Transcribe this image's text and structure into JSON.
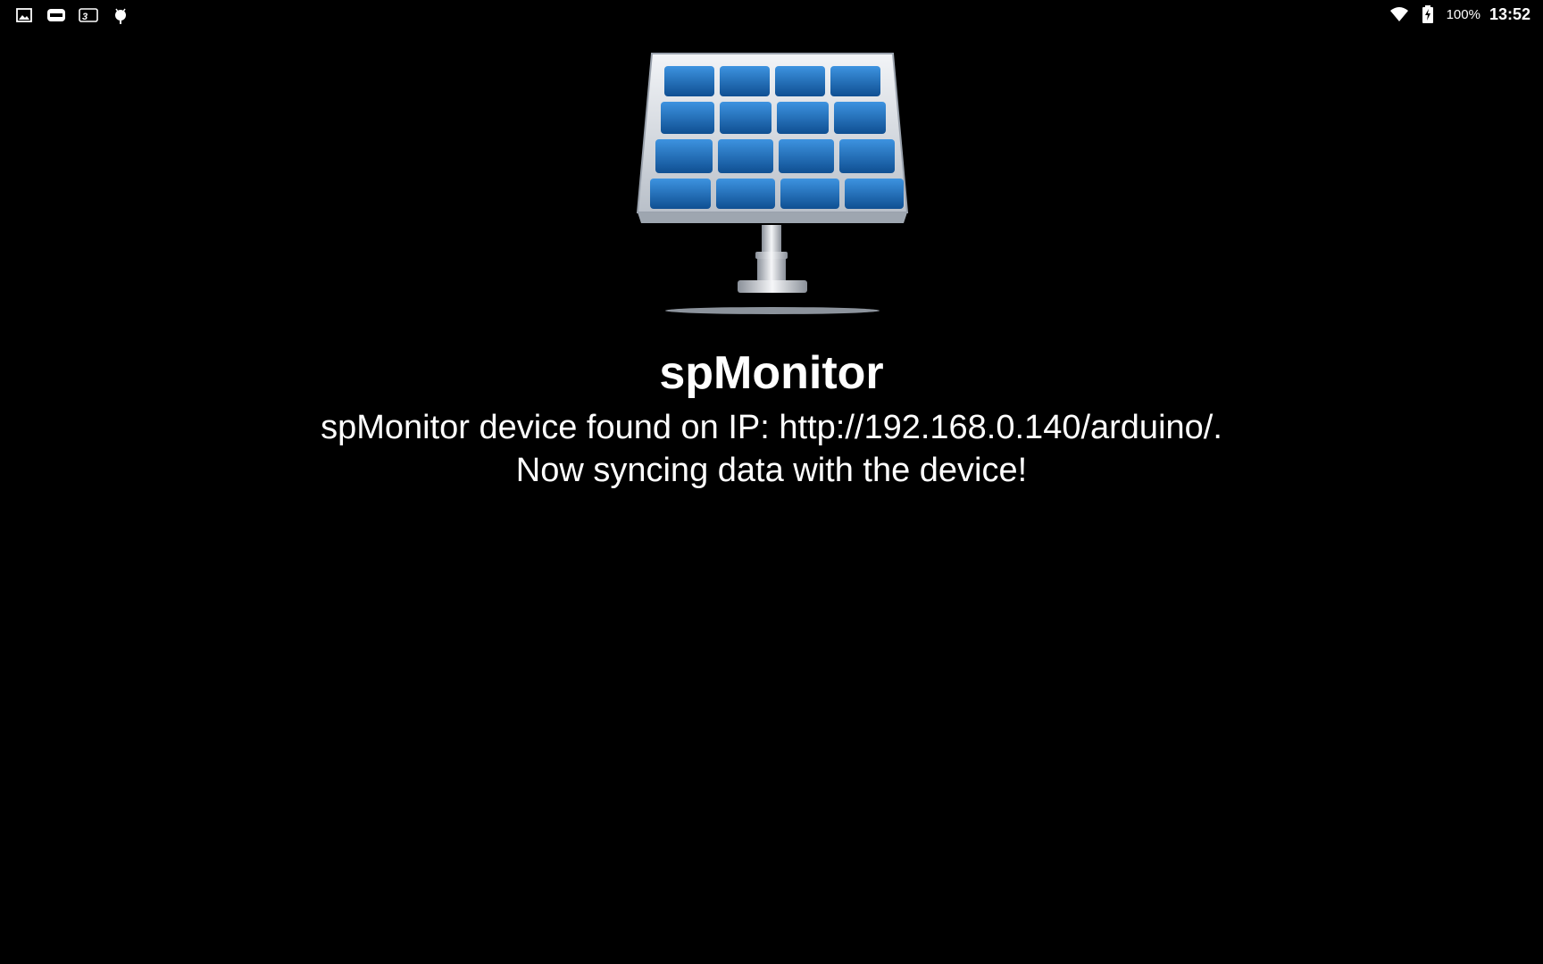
{
  "status_bar": {
    "left_icons": [
      "gallery-icon",
      "gamepad-icon",
      "3d-app-icon",
      "android-debug-icon"
    ],
    "right_icons": [
      "wifi-icon",
      "battery-charging-icon"
    ],
    "battery_percent": "100%",
    "time": "13:52"
  },
  "splash": {
    "logo_icon": "solar-panel-icon",
    "title": "spMonitor",
    "message_line1": "spMonitor device found on IP: http://192.168.0.140/arduino/.",
    "message_line2": "Now syncing data with the device!"
  },
  "colors": {
    "background": "#000000",
    "text": "#ffffff",
    "panel_blue": "#1f6fbf"
  }
}
